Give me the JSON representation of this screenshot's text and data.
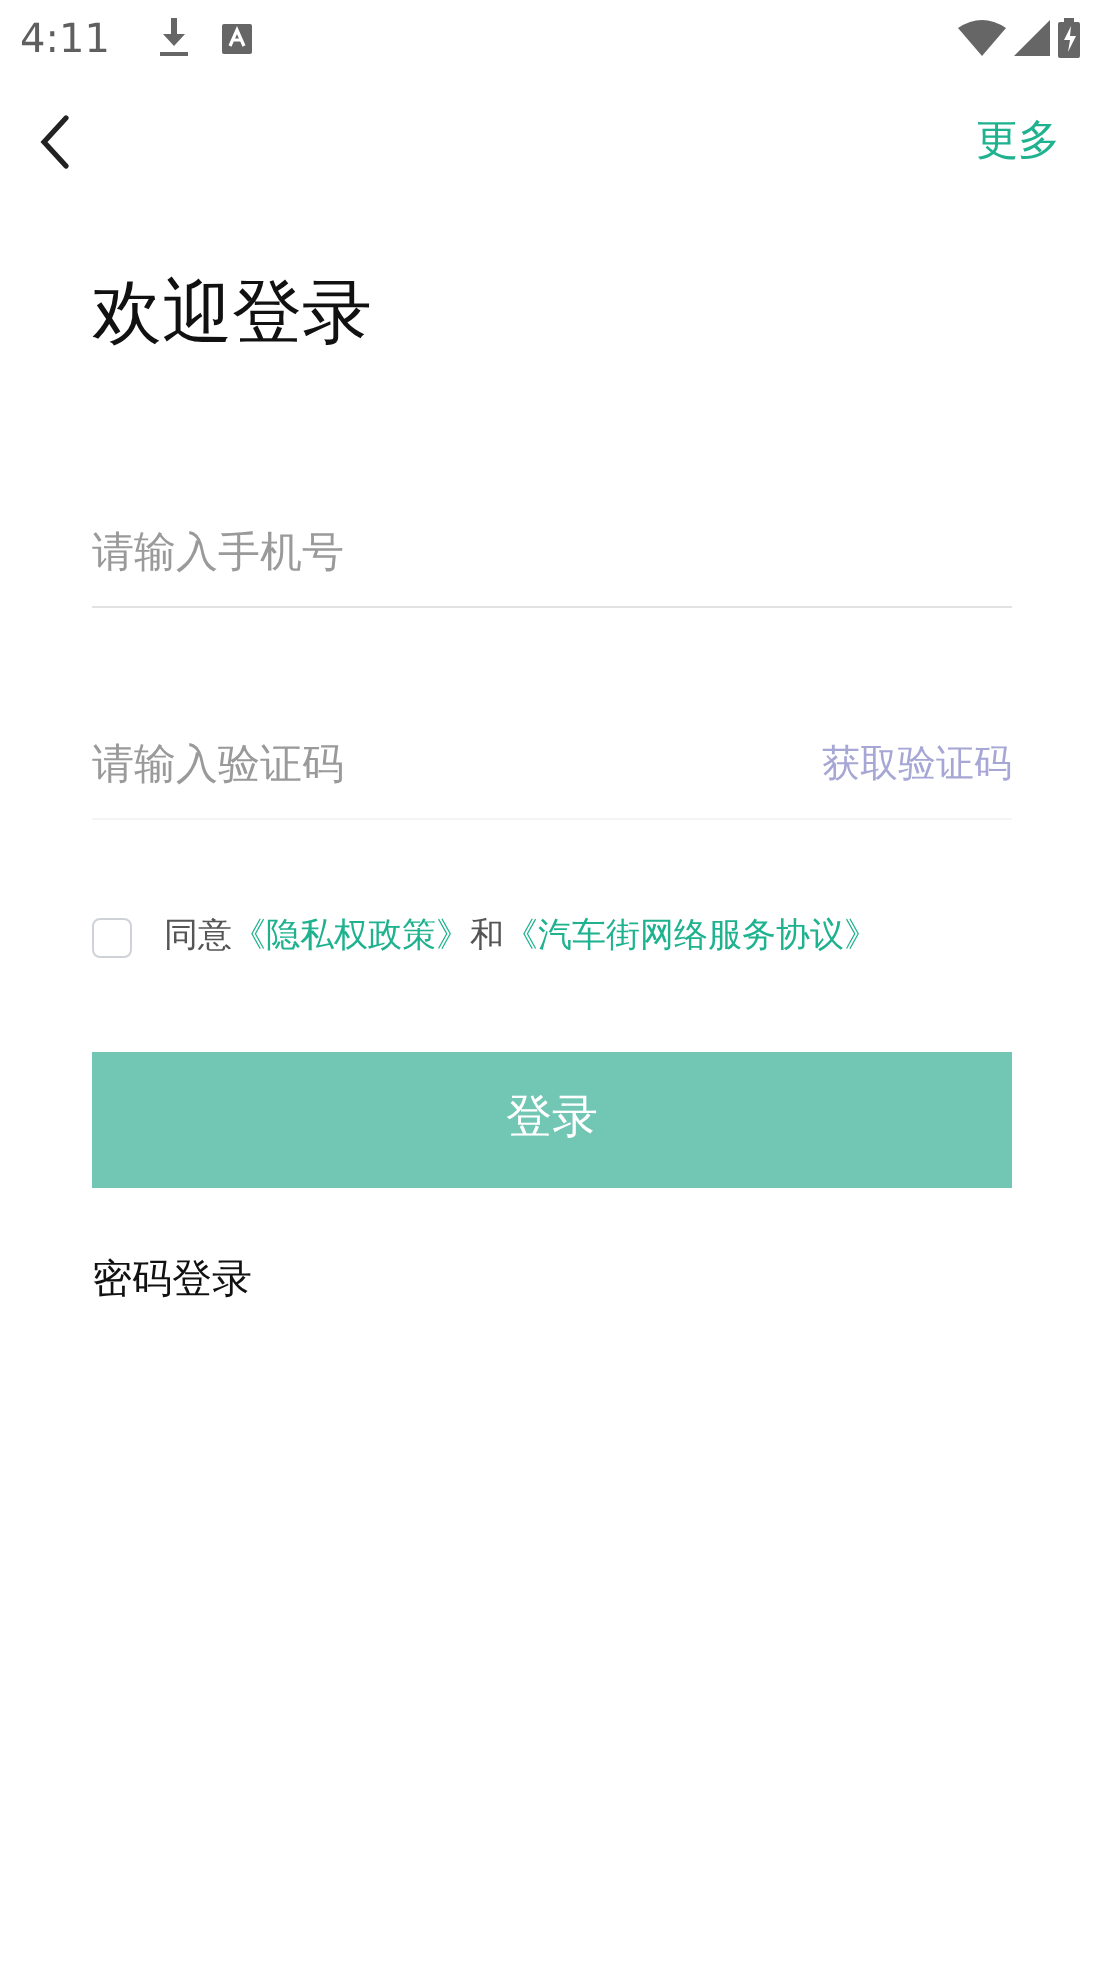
{
  "status_bar": {
    "time": "4:11"
  },
  "toolbar": {
    "more": "更多"
  },
  "title": "欢迎登录",
  "phone_field": {
    "placeholder": "请输入手机号"
  },
  "code_field": {
    "placeholder": "请输入验证码",
    "action": "获取验证码"
  },
  "agreement": {
    "checked": false,
    "parts": [
      {
        "kind": "text",
        "text": "同意"
      },
      {
        "kind": "link",
        "text": "《隐私权政策》"
      },
      {
        "kind": "text",
        "text": "和"
      },
      {
        "kind": "link",
        "text": "《汽车街网络服务协议》"
      }
    ]
  },
  "login_button": {
    "label": "登录",
    "disabled": true
  },
  "password_login": "密码登录"
}
